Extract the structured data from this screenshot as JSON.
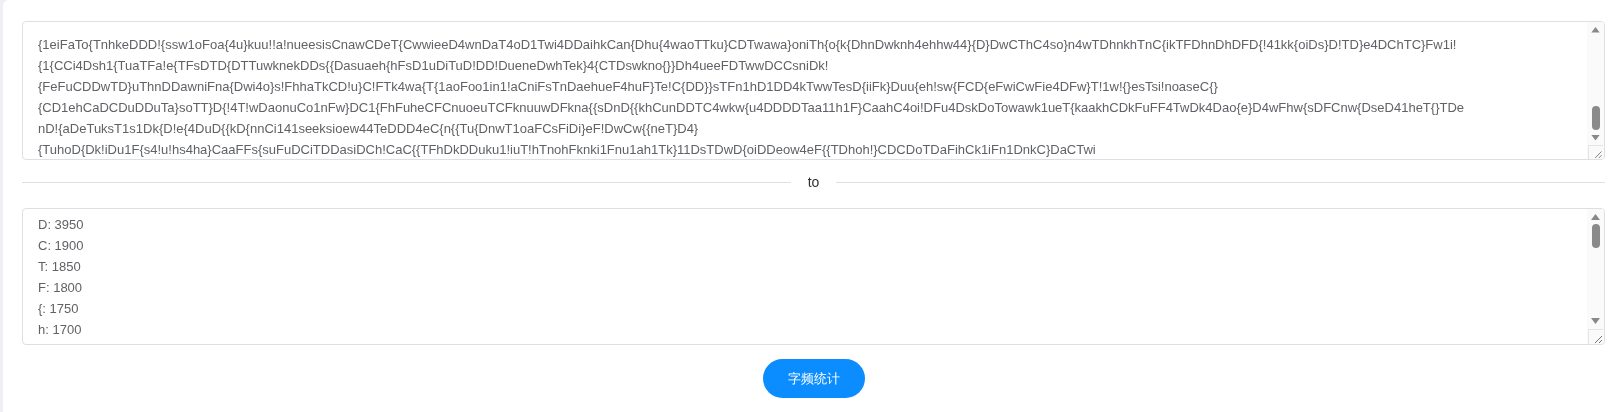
{
  "input": {
    "lines": [
      "{1eiFaTo{TnhkeDDD!{ssw1oFoa{4u}kuu!!a!nueesisCnawCDeT{CwwieeD4wnDaT4oD1Twi4DDaihkCan{Dhu{4waoTTku}CDTwawa}oniTh{o{k{DhnDwknh4ehhw44}{D}DwCThC4so}n4wTDhnkhTnC{ikTFDhnDhDFD{!41kk{oiDs}D!TD}e4DChTC}Fw1i!",
      "{1{CCi4Dsh1{TuaTFa!e{TFsDTD{DTTuwknekDDs{{Dasuaeh{hFsD1uDiTuD!DD!DueneDwhTek}4{CTDswkno{}}Dh4ueeFDTwwDCCsniDk!",
      "{FeFuCDDwTD}uThnDDawniFna{Dwi4o}s!FhhaTkCD!u}C!FTk4wa{T{1aoFoo1in1!aCniFsTnDaehueF4huF}Te!C{DD}}sTFn1hD1DD4kTwwTesD{iiFk}Duu{eh!sw{FCD{eFwiCwFie4DFw}T!1w!{}esTsi!noaseC{}",
      "{CD1ehCaDCDuDDuTa}soTT}D{!4T!wDaonuCo1nFw}DC1{FhFuheCFCnuoeuTCFknuuwDFkna{{sDnD{{khCunDDTC4wkw{u4DDDDTaa11h1F}CaahC4oi!DFu4DskDoTowawk1ueT{kaakhCDkFuFF4TwDk4Dao{e}D4wFhw{sDFCnw{DseD41heT{}TDe",
      "nD!{aDeTuksT1s1Dk{D!e{4DuD{{kD{nnCi141seeksioew44TeDDD4eC{n{{Tu{DnwT1oaFCsFiDi}eF!DwCw{{neT}D4}",
      "{TuhoD{Dk!iDu1F{s4!u!hs4ha}CaaFFs{suFuDCiTDDasiDCh!CaC{{TFhDkDDuku1!iuT!hTnohFknki1Fnu1ah1Tk}11DsTDwD{oiDDeow4eF{{TDhoh!}CDCDoTDaFihCk1iFn1DnkC}DaCTwi"
    ]
  },
  "divider": {
    "label": "to"
  },
  "output": {
    "lines": [
      "D: 3950",
      "C: 1900",
      "T: 1850",
      "F: 1800",
      "{: 1750",
      "h: 1700"
    ]
  },
  "button": {
    "label": "字频统计"
  }
}
